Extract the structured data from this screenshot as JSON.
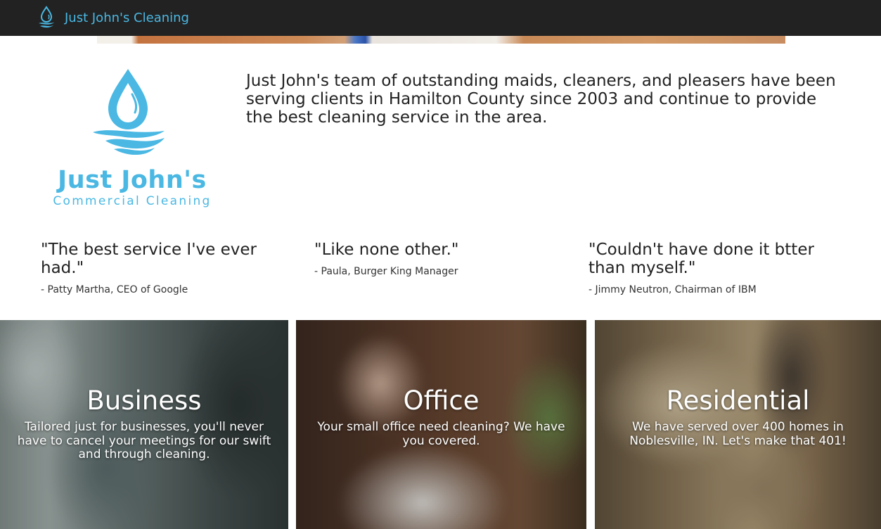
{
  "navbar": {
    "brand_label": "Just John's Cleaning",
    "brand_icon": "water-drop-icon",
    "background_color": "#222222",
    "accent_color": "#4ab8e3"
  },
  "intro": {
    "logo": {
      "title": "Just John's",
      "subtitle": "Commercial Cleaning",
      "icon": "water-drop-wave-icon"
    },
    "text": "Just John's team of outstanding maids, cleaners, and pleasers have been serving clients in Hamilton County since 2003 and continue to provide the best cleaning service in the area."
  },
  "testimonials": [
    {
      "quote": "\"The best service I've ever had.\"",
      "author": "- Patty Martha, CEO of Google"
    },
    {
      "quote": "\"Like none other.\"",
      "author": "- Paula, Burger King Manager"
    },
    {
      "quote": "\"Couldn't have done it btter than myself.\"",
      "author": "- Jimmy Neutron, Chairman of IBM"
    }
  ],
  "services": [
    {
      "title": "Business",
      "description": "Tailored just for businesses, you'll never have to cancel your meetings for our swift and through cleaning."
    },
    {
      "title": "Office",
      "description": "Your small office need cleaning? We have you covered."
    },
    {
      "title": "Residential",
      "description": "We have served over 400 homes in Noblesville, IN. Let's make that 401!"
    }
  ]
}
